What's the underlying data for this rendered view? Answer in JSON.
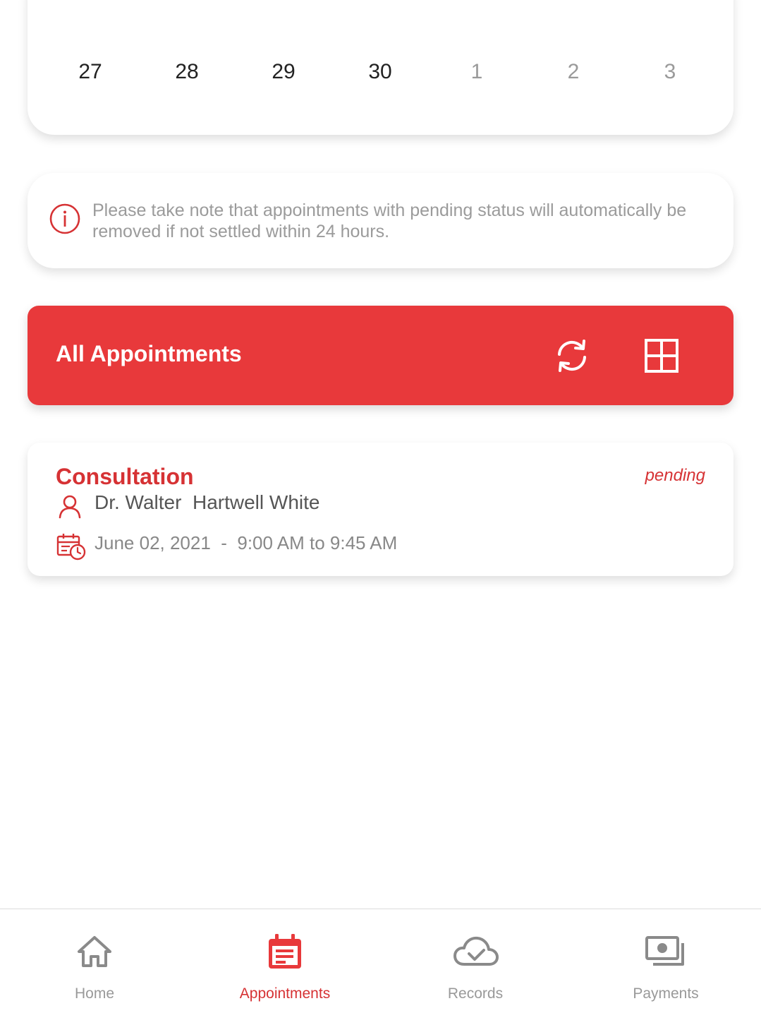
{
  "calendar": {
    "days": [
      {
        "label": "27",
        "muted": false
      },
      {
        "label": "28",
        "muted": false
      },
      {
        "label": "29",
        "muted": false
      },
      {
        "label": "30",
        "muted": false
      },
      {
        "label": "1",
        "muted": true
      },
      {
        "label": "2",
        "muted": true
      },
      {
        "label": "3",
        "muted": true
      }
    ]
  },
  "notice": {
    "icon": "info-icon",
    "text": "Please take note that appointments with pending status will automatically be removed if not settled within 24 hours."
  },
  "appointments_header": {
    "title": "All Appointments",
    "refresh_icon": "refresh-icon",
    "grid_icon": "grid-view-icon"
  },
  "appointment": {
    "type": "Consultation",
    "status": "pending",
    "doctor": "Dr. Walter  Hartwell White",
    "date": "June 02, 2021",
    "separator": "-",
    "time": "9:00 AM to 9:45 AM",
    "schedule": "June 02, 2021  -  9:00 AM to 9:45 AM"
  },
  "bottom_nav": {
    "items": [
      {
        "label": "Home",
        "icon": "home-icon",
        "active": false
      },
      {
        "label": "Appointments",
        "icon": "calendar-icon",
        "active": true
      },
      {
        "label": "Records",
        "icon": "cloud-check-icon",
        "active": false
      },
      {
        "label": "Payments",
        "icon": "payments-icon",
        "active": false
      }
    ]
  },
  "colors": {
    "accent": "#e8393b",
    "accent_text": "#d63234",
    "muted_text": "#999999"
  }
}
